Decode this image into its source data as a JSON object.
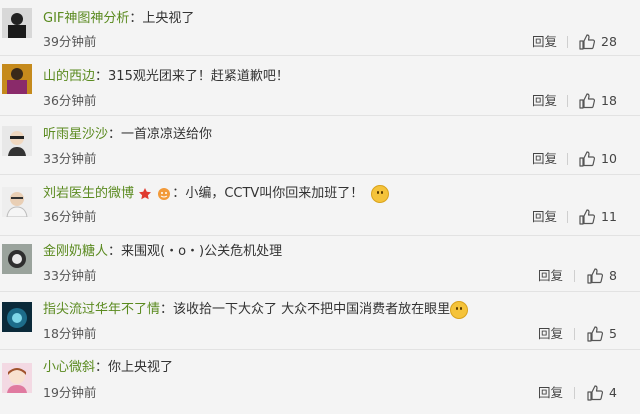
{
  "comments": [
    {
      "user": "GIF神图神分析",
      "text": "上央视了",
      "time": "39分钟前",
      "reply": "回复",
      "likes": "28"
    },
    {
      "user": "山的西边",
      "text": "315观光团来了！赶紧道歉吧！",
      "time": "36分钟前",
      "reply": "回复",
      "likes": "18"
    },
    {
      "user": "听雨星沙沙",
      "text": "一首凉凉送给你",
      "time": "33分钟前",
      "reply": "回复",
      "likes": "10"
    },
    {
      "user": "刘岩医生的微博",
      "text": "小编，CCTV叫你回来加班了！",
      "time": "36分钟前",
      "reply": "回复",
      "likes": "11"
    },
    {
      "user": "金刚奶糖人",
      "text": "来围观(・o・)公关危机处理",
      "time": "33分钟前",
      "reply": "回复",
      "likes": "8"
    },
    {
      "user": "指尖流过华年不了情",
      "text": "该收拾一下大众了 大众不把中国消费者放在眼里",
      "time": "18分钟前",
      "reply": "回复",
      "likes": "5"
    },
    {
      "user": "小心微斜",
      "text": "你上央视了",
      "time": "19分钟前",
      "reply": "回复",
      "likes": "4"
    }
  ],
  "colors": {
    "username": "#5a8a1f",
    "text": "#333333",
    "meta": "#555555",
    "background": "#f4f4f4"
  },
  "icons": {
    "thumb": "thumbs-up-icon",
    "star_badge": "star-icon",
    "vip_badge": "vip-badge-icon",
    "emoji": "smiley-emoji-icon"
  }
}
